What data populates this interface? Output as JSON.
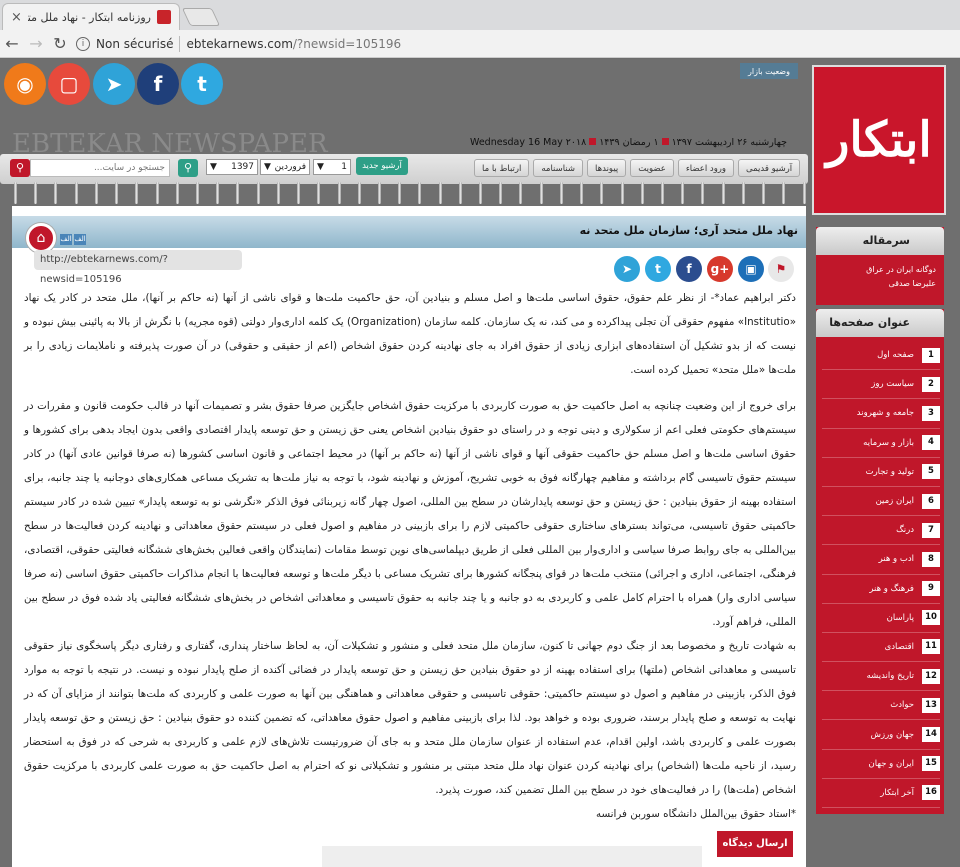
{
  "browser": {
    "tab_title": "روزنامه ابتکار - نهاد ملل متحد",
    "security_label": "Non sécurisé",
    "url_host": "ebtekarnews.com",
    "url_path": "/?newsid=105196"
  },
  "header": {
    "market_label": "وضعیت بازار",
    "newspaper_name": "EBTEKAR NEWSPAPER",
    "date_fa": "چهارشنبه ۲۶ اردیبهشت ۱۳۹۷",
    "date_hijri": "۱ رمضان ۱۴۳۹",
    "date_en": "Wednesday 16 May ۲۰۱۸",
    "social_icons": [
      "twitter-icon",
      "facebook-icon",
      "telegram-icon",
      "instagram-icon",
      "rss-icon"
    ]
  },
  "toolbar": {
    "search_placeholder": "جستجو در سایت...",
    "year": "1397",
    "month": "فروردین",
    "day": "1",
    "archive_label": "آرشیو جدید",
    "nav": [
      "آرشیو قدیمی",
      "ورود اعضاء",
      "عضویت",
      "پیوندها",
      "شناسنامه",
      "ارتباط با ما"
    ]
  },
  "article": {
    "title": "نهاد ملل متحد آری؛ سازمان ملل متحد نه",
    "font_small": "الف",
    "font_large": "الف",
    "short_url": "http://ebtekarnews.com/?newsid=105196",
    "p1": "دکتر ابراهیم عماد*- از نظر علم حقوق، حقوق اساسی ملت‌ها و اصل مسلم و بنیادین آن، حق حاکمیت ملت‌ها و قوای ناشی از آنها (نه حاکم بر آنها)، ملل متحد در کادر یک نهاد «Institutio» مفهوم حقوقی آن تجلی پیداکرده و می کند، نه یک سازمان. کلمه سازمان (Organization) یک کلمه اداری‌وار دولتی (قوه مجریه) با نگرش از بالا به پائینی بیش نبوده و نیست که از بدو تشکیل آن استفاده‌های ابزاری زیادی از حقوق افراد به جای نهادینه کردن حقوق اشخاص (اعم از حقیقی و حقوقی) در آن صورت پذیرفته و ناملایمات زیادی را بر ملت‌ها «ملل متحد» تحمیل کرده است.",
    "p2": "برای خروج از این وضعیت چنانچه به اصل حاکمیت حق به صورت کاربردی با مرکزیت حقوق اشخاص جایگزین صرفا حقوق بشر و تصمیمات آنها در قالب حکومت قانون و مقررات در سیستم‌های حکومتی فعلی اعم از سکولاری و دینی توجه و در راستای دو حقوق بنیادین اشخاص یعنی حق زیستن و حق توسعه پایدار اقتصادی واقعی بدون ایجاد بدهی برای کشورها و حقوق اساسی ملت‌ها و اصل مسلم حق حاکمیت حقوقی آنها و قوای ناشی از آنها (نه حاکم بر آنها) در محیط اجتماعی و قانون اساسی کشورها (نه صرفا قوانین عادی آنها) در کادر سیستم حقوق تاسیسی گام برداشته و مفاهیم چهارگانه فوق به خوبی تشریح، آموزش و نهادینه شود، با توجه به نیاز ملت‌ها به تشریک مساعی همکاری‌های دوجانبه یا چند جانبه، برای استفاده بهینه از حقوق بنیادین : حق زیستن و حق توسعه پایدارشان در سطح بین المللی، اصول چهار گانه زیربنائی فوق الذکر «نگرشی نو به توسعه پایدار» تبیین شده در کادر سیستم حاکمیتی حقوق تاسیسی، می‌تواند بسترهای ساختاری حقوقی حاکمیتی لازم را برای بازبینی در مفاهیم و اصول فعلی در سیستم حقوق معاهداتی و نهادینه کردن فعالیت‌ها در سطح بین‌المللی به جای روابط صرفا سیاسی و اداری‌وار بین المللی فعلی از طریق دیپلماسی‌های نوین توسط مقامات (نمایندگان واقعی فعالین بخش‌های ششگانه فعالیتی حقوقی، اقتصادی، فرهنگی، اجتماعی، اداری و اجرائی) منتخب ملت‌ها در قوای پنجگانه کشورها برای تشریک مساعی با دیگر ملت‌ها و توسعه فعالیت‌ها با انجام مذاکرات حاکمیتی حقوق اساسی (نه صرفا سیاسی اداری وار) همراه با احترام کامل علمی و کاربردی به دو جانبه و یا چند جانبه به حقوق تاسیسی و معاهداتی اشخاص در بخش‌های ششگانه فعالیتی یاد شده فوق در سطح بین المللی، فراهم آورد.",
    "p3": "به شهادت تاریخ و مخصوصا بعد از جنگ دوم جهانی تا کنون، سازمان ملل متحد فعلی و منشور و تشکیلات آن، به لحاظ ساختار پنداری، گفتاری و رفتاری دیگر پاسخگوی نیاز حقوقی تاسیسی و معاهداتی اشخاص (ملتها) برای استفاده بهینه از دو حقوق بنیادین حق زیستن و حق توسعه پایدار در فضائی آکنده از صلح پایدار نبوده و نیست. در نتیجه با توجه به موارد فوق الذکر، بازبینی در مفاهیم و اصول دو سیستم حاکمیتی: حقوقی تاسیسی و حقوقی معاهداتی و هماهنگی بین آنها به صورت علمی و کاربردی که ملت‌ها بتوانند از مزایای آن که در نهایت به توسعه و صلح پایدار برسند، ضروری بوده و خواهد بود. لذا برای بازبینی مفاهیم و اصول حقوق معاهداتی، که تضمین کننده دو حقوق بنیادین : حق زیستن و حق توسعه پایدار بصورت علمی و کاربردی باشد، اولین اقدام، عدم استفاده از عنوان سازمان ملل متحد و به جای آن ضرورتیست تلاش‌های لازم علمی و کاربردی به شرحی که در فوق به استحضار رسید، از ناحیه ملت‌ها (اشخاص) برای نهادینه کردن عنوان نهاد ملل متحد مبتنی بر منشور و تشکیلاتی نو که احترام به اصل حاکمیت حق به صورت علمی کاربردی با مرکزیت حقوق اشخاص (ملت‌ها) را در فعالیت‌های خود در سطح بین الملل تضمین کند، صورت پذیرد.",
    "footnote": "*استاد حقوق بین‌الملل دانشگاه سوربن فرانسه",
    "send_button": "ارسال دیدگاه",
    "share_icons": [
      "flag-icon",
      "save-icon",
      "google-plus-icon",
      "facebook-icon",
      "twitter-icon",
      "telegram-icon"
    ]
  },
  "sidebar": {
    "logo_text": "ابتکار",
    "editorial": {
      "heading": "سرمقاله",
      "line1": "دوگانه ایران در عراق",
      "line2": "علیرضا صدقی"
    },
    "pages_heading": "عنوان صفحه‌ها",
    "pages": [
      {
        "num": "1",
        "label": "صفحه اول"
      },
      {
        "num": "2",
        "label": "سیاست روز"
      },
      {
        "num": "3",
        "label": "جامعه و شهروند"
      },
      {
        "num": "4",
        "label": "بازار و سرمایه"
      },
      {
        "num": "5",
        "label": "تولید و تجارت"
      },
      {
        "num": "6",
        "label": "ایران زمین"
      },
      {
        "num": "7",
        "label": "درنگ"
      },
      {
        "num": "8",
        "label": "ادب و هنر"
      },
      {
        "num": "9",
        "label": "فرهنگ و هنر"
      },
      {
        "num": "10",
        "label": "پاراسان"
      },
      {
        "num": "11",
        "label": "اقتصادی"
      },
      {
        "num": "12",
        "label": "تاریخ واندیشه"
      },
      {
        "num": "13",
        "label": "حوادث"
      },
      {
        "num": "14",
        "label": "جهان ورزش"
      },
      {
        "num": "15",
        "label": "ایران و جهان"
      },
      {
        "num": "16",
        "label": "آخر ابتکار"
      }
    ]
  },
  "colors": {
    "brand_red": "#c0172a",
    "teal": "#2e9f87",
    "title_blue": "#8fb6cb"
  }
}
